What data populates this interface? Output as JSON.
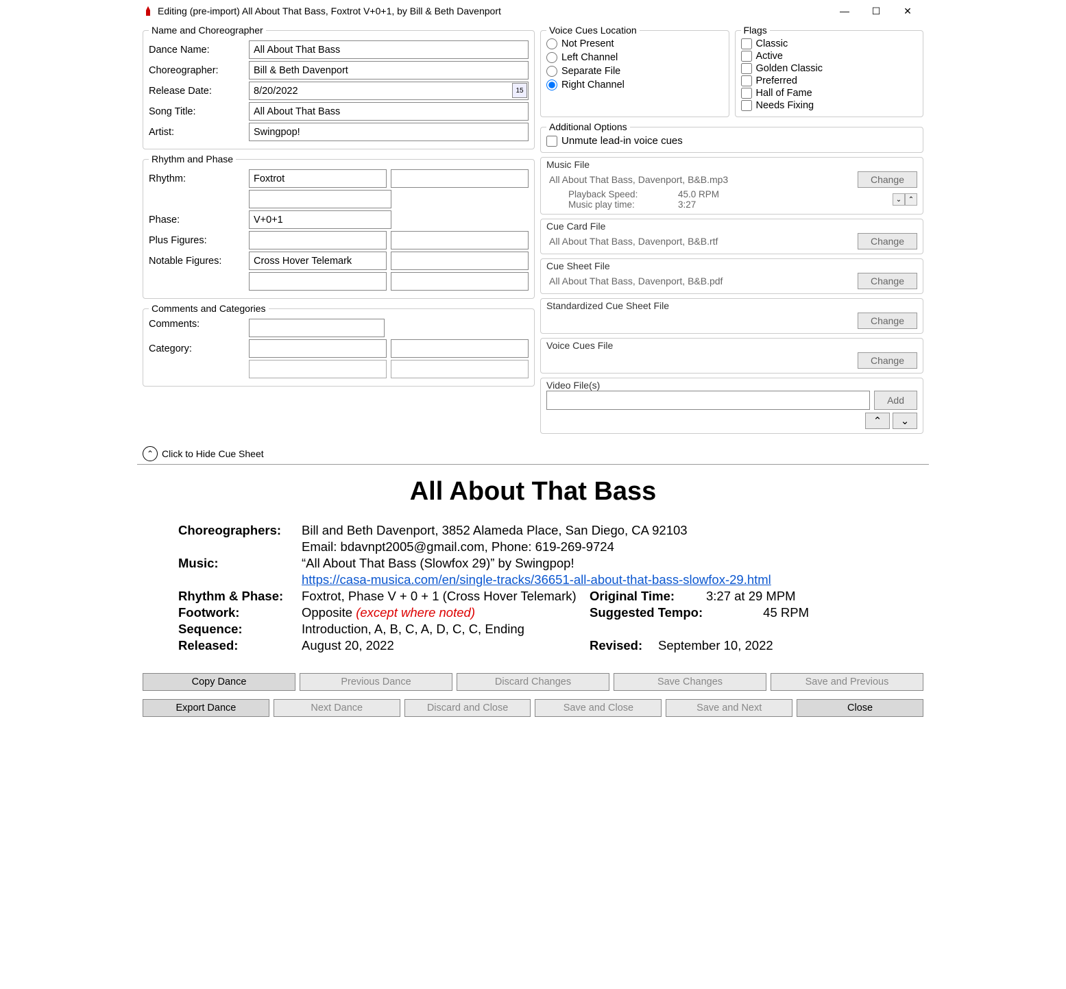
{
  "window": {
    "title": "Editing (pre-import) All About That Bass, Foxtrot V+0+1, by Bill & Beth Davenport"
  },
  "nameGroup": {
    "legend": "Name and Choreographer",
    "danceNameLabel": "Dance Name:",
    "danceName": "All About That Bass",
    "choreoLabel": "Choreographer:",
    "choreo": "Bill & Beth Davenport",
    "releaseLabel": "Release Date:",
    "release": "8/20/2022",
    "songLabel": "Song Title:",
    "song": "All About That Bass",
    "artistLabel": "Artist:",
    "artist": "Swingpop!"
  },
  "rhythmGroup": {
    "legend": "Rhythm and Phase",
    "rhythmLabel": "Rhythm:",
    "rhythm": "Foxtrot",
    "phaseLabel": "Phase:",
    "phase": "V+0+1",
    "plusLabel": "Plus Figures:",
    "notableLabel": "Notable Figures:",
    "notable": "Cross Hover Telemark"
  },
  "commentsGroup": {
    "legend": "Comments and Categories",
    "commentsLabel": "Comments:",
    "categoryLabel": "Category:"
  },
  "voice": {
    "legend": "Voice Cues Location",
    "opt1": "Not Present",
    "opt2": "Left Channel",
    "opt3": "Separate File",
    "opt4": "Right Channel"
  },
  "flags": {
    "legend": "Flags",
    "f1": "Classic",
    "f2": "Active",
    "f3": "Golden Classic",
    "f4": "Preferred",
    "f5": "Hall of Fame",
    "f6": "Needs Fixing"
  },
  "addl": {
    "legend": "Additional Options",
    "unmute": "Unmute lead-in voice cues"
  },
  "music": {
    "legend": "Music File",
    "file": "All About That Bass, Davenport, B&B.mp3",
    "speedLabel": "Playback Speed:",
    "speed": "45.0 RPM",
    "timeLabel": "Music play time:",
    "time": "3:27",
    "change": "Change"
  },
  "cuecard": {
    "legend": "Cue Card File",
    "file": "All About That Bass, Davenport, B&B.rtf",
    "change": "Change"
  },
  "cuesheet": {
    "legend": "Cue Sheet File",
    "file": "All About That Bass, Davenport, B&B.pdf",
    "change": "Change"
  },
  "stdcue": {
    "legend": "Standardized Cue Sheet File",
    "change": "Change"
  },
  "voicefile": {
    "legend": "Voice Cues File",
    "change": "Change"
  },
  "video": {
    "legend": "Video File(s)",
    "add": "Add"
  },
  "toggle": "Click to Hide Cue Sheet",
  "sheet": {
    "title": "All About That Bass",
    "choreoK": "Choreographers:",
    "choreoV": "Bill and Beth Davenport, 3852 Alameda Place, San Diego, CA 92103",
    "choreoV2": "Email: bdavnpt2005@gmail.com, Phone: 619-269-9724",
    "musicK": "Music:",
    "musicV": "“All About That Bass (Slowfox 29)” by Swingpop!",
    "musicLink": "https://casa-musica.com/en/single-tracks/36651-all-about-that-bass-slowfox-29.html",
    "rpK": "Rhythm & Phase:",
    "rpV": "Foxtrot, Phase V + 0 + 1 (Cross Hover Telemark)",
    "otK": "Original Time:",
    "otV": "3:27 at 29 MPM",
    "fwK": "Footwork:",
    "fwV1": "Opposite ",
    "fwV2": "(except where noted)",
    "stK": "Suggested Tempo:",
    "stV": "45 RPM",
    "seqK": "Sequence:",
    "seqV": "Introduction, A, B, C, A, D, C, C, Ending",
    "relK": "Released:",
    "relV": "August 20, 2022",
    "revK": "Revised:",
    "revV": "September 10, 2022"
  },
  "footer": {
    "copy": "Copy Dance",
    "prev": "Previous Dance",
    "discard": "Discard Changes",
    "save": "Save Changes",
    "savePrev": "Save and Previous",
    "export": "Export Dance",
    "next": "Next Dance",
    "discardClose": "Discard and Close",
    "saveClose": "Save and Close",
    "saveNext": "Save and Next",
    "close": "Close"
  }
}
